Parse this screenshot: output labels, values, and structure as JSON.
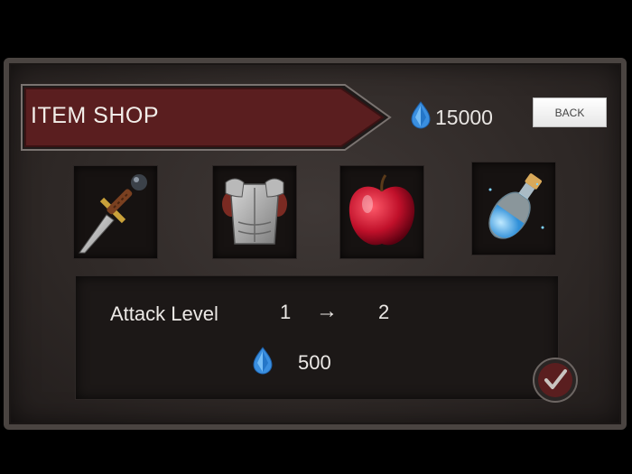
{
  "header": {
    "title": "ITEM SHOP",
    "gem_balance": "15000",
    "back_label": "BACK"
  },
  "items": [
    {
      "name": "sword-icon"
    },
    {
      "name": "armor-icon"
    },
    {
      "name": "apple-icon"
    },
    {
      "name": "potion-icon"
    }
  ],
  "details": {
    "stat_label": "Attack Level",
    "from_level": "1",
    "arrow": "→",
    "to_level": "2",
    "cost": "500"
  },
  "colors": {
    "banner": "#5a1e1f",
    "gem": "#3a8fe0",
    "confirm": "#5a1e1f"
  }
}
